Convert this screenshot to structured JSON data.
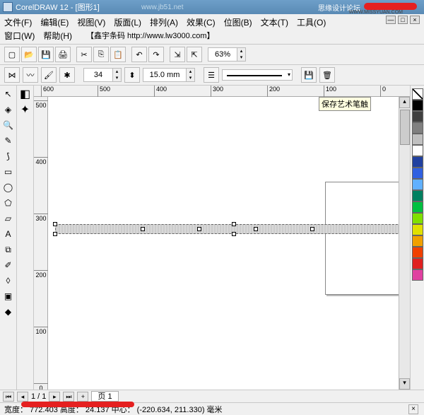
{
  "titlebar": {
    "title": "CorelDRAW 12 - [图形1]",
    "url": "www.jb51.net",
    "right_text": "思缘设计论坛",
    "tiny_text": "WWW.MISSYUAN.COM"
  },
  "menu": {
    "file": "文件(F)",
    "edit": "编辑(E)",
    "view": "视图(V)",
    "layout": "版面(L)",
    "arrange": "排列(A)",
    "effects": "效果(C)",
    "bitmaps": "位图(B)",
    "text": "文本(T)",
    "tools": "工具(O)",
    "window": "窗口(W)",
    "help": "帮助(H)",
    "extra": "【鑫宇条码 http://www.lw3000.com】"
  },
  "toolbar1": {
    "zoom": "63%"
  },
  "toolbar2": {
    "preset": "34",
    "width": "15.0 mm"
  },
  "ruler_h": [
    "600",
    "500",
    "400",
    "300",
    "200",
    "100",
    "0"
  ],
  "ruler_v": [
    "500",
    "400",
    "300",
    "200",
    "100",
    "0"
  ],
  "tooltip": "保存艺术笔触",
  "pagenav": {
    "pages": "1 / 1",
    "tab": "页 1"
  },
  "status": {
    "dims": "宽度： 772.403  高度： 24.137  中心：  (-220.634, 211.330)  毫米"
  },
  "palette_colors": [
    "#000000",
    "#404040",
    "#808080",
    "#c0c0c0",
    "#ffffff",
    "#2040a0",
    "#3060e0",
    "#60b0ff",
    "#008060",
    "#00c040",
    "#80e000",
    "#e0e000",
    "#f0a000",
    "#f04000",
    "#e02020",
    "#e040a0"
  ],
  "win_btns": {
    "min": "—",
    "max": "□",
    "close": "×"
  }
}
